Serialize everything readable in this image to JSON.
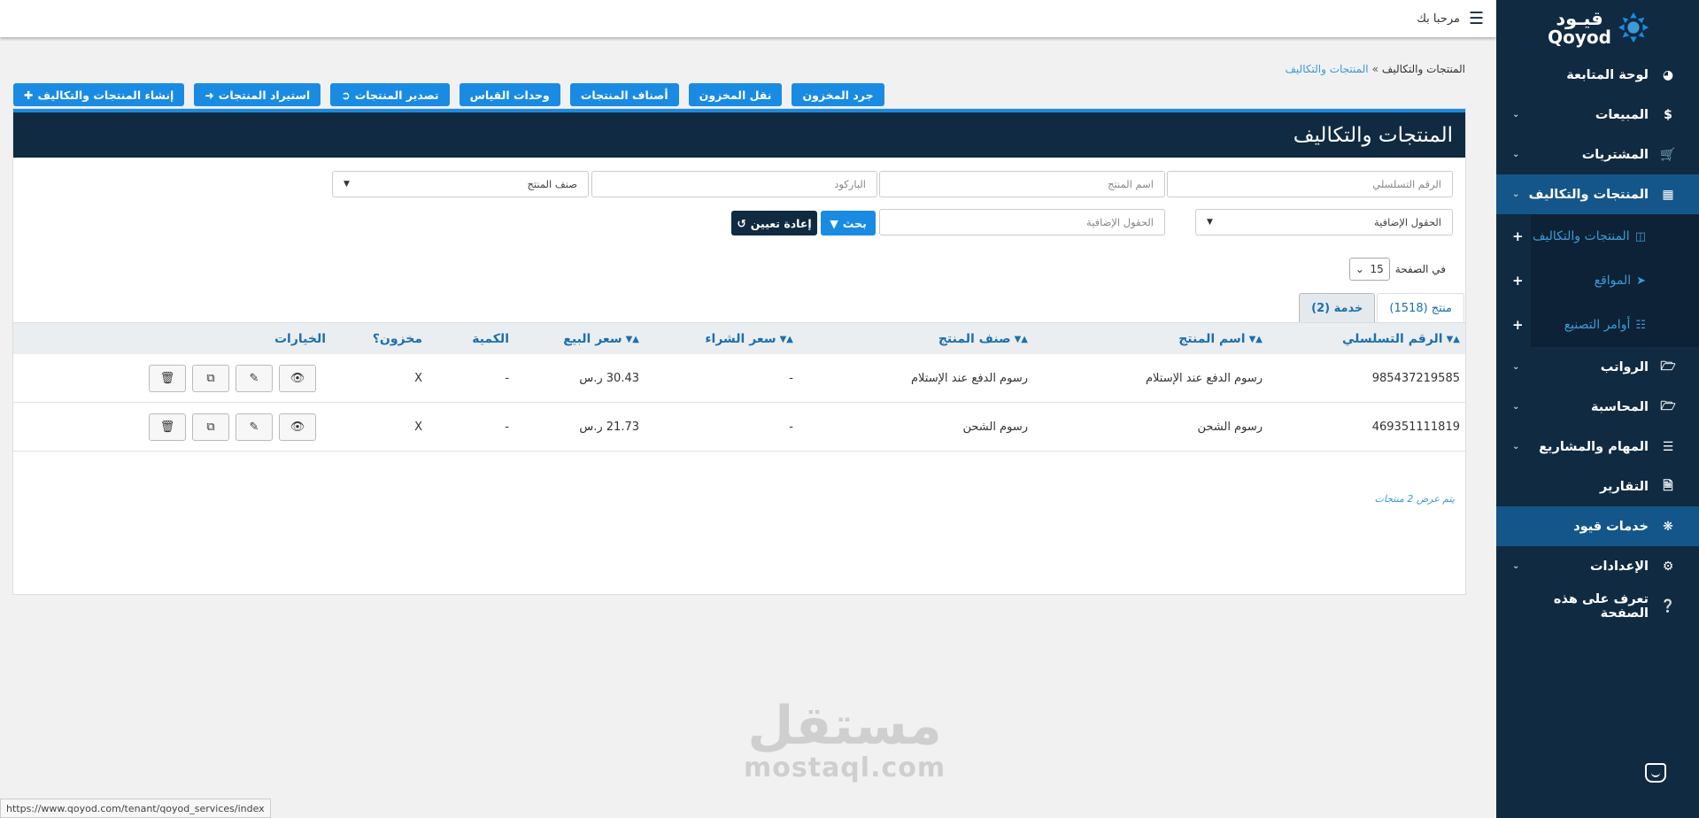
{
  "topbar": {
    "welcome": "مرحبا بك"
  },
  "sidebar": {
    "logo_ar": "قيـود",
    "logo_en": "Qoyod",
    "items": [
      {
        "label": "لوحة المتابعة",
        "icon": "dashboard-icon"
      },
      {
        "label": "المبيعات",
        "icon": "dollar-icon"
      },
      {
        "label": "المشتريات",
        "icon": "cart-icon"
      },
      {
        "label": "المنتجات والتكاليف",
        "icon": "grid-icon"
      },
      {
        "label": "الرواتب",
        "icon": "folder-icon"
      },
      {
        "label": "المحاسبة",
        "icon": "folder-icon"
      },
      {
        "label": "المهام والمشاريع",
        "icon": "list-icon"
      },
      {
        "label": "التقارير",
        "icon": "file-icon"
      },
      {
        "label": "خدمات قيود",
        "icon": "services-icon"
      },
      {
        "label": "الإعدادات",
        "icon": "gear-icon"
      },
      {
        "label": "تعرف على هذه الصفحة",
        "icon": "question-icon"
      }
    ],
    "subitems": [
      {
        "label": "المنتجات والتكاليف",
        "icon": "cubes-icon"
      },
      {
        "label": "المواقع",
        "icon": "location-arrow-icon"
      },
      {
        "label": "أوامر التصنيع",
        "icon": "sitemap-icon"
      }
    ]
  },
  "breadcrumb": {
    "current": "المنتجات والتكاليف",
    "sep": "»",
    "link": "المنتجات والتكاليف"
  },
  "actions": {
    "create": "إنشاء المنتجات والتكاليف",
    "import": "استيراد المنتجات",
    "export": "تصدير المنتجات",
    "units": "وحدات القياس",
    "categories": "أصناف المنتجات",
    "transfer": "نقل المخزون",
    "inventory": "جرد المخزون"
  },
  "panel": {
    "title": "المنتجات والتكاليف"
  },
  "filters": {
    "serial_placeholder": "الرقم التسلسلي",
    "name_placeholder": "اسم المنتج",
    "barcode_placeholder": "الباركود",
    "category_select": "صنف المنتج",
    "extra_select": "الحقول الإضافية",
    "extra_placeholder": "الحقول الإضافية",
    "search_label": "بحث",
    "reset_label": "إعادة تعيين"
  },
  "perpage": {
    "label": "في الصفحة",
    "value": "15"
  },
  "tabs": [
    {
      "label": "منتج (1518)"
    },
    {
      "label": "خدمة (2)"
    }
  ],
  "table": {
    "headers": {
      "serial": "الرقم التسلسلي",
      "name": "اسم المنتج",
      "category": "صنف المنتج",
      "buy": "سعر الشراء",
      "sell": "سعر البيع",
      "qty": "الكمية",
      "stocked": "مخزون؟",
      "options": "الخيارات"
    },
    "rows": [
      {
        "serial": "985437219585",
        "name": "رسوم الدفع عند الإستلام",
        "category": "رسوم الدفع عند الإستلام",
        "buy": "-",
        "sell": "30.43 ر.س",
        "qty": "-",
        "stocked": "X"
      },
      {
        "serial": "469351111819",
        "name": "رسوم الشحن",
        "category": "رسوم الشحن",
        "buy": "-",
        "sell": "21.73 ر.س",
        "qty": "-",
        "stocked": "X"
      }
    ]
  },
  "showing": "يتم عرض 2 منتجات",
  "watermark": {
    "ar": "مستقل",
    "en": "mostaql.com"
  },
  "statusbar": "https://www.qoyod.com/tenant/qoyod_services/index",
  "colors": {
    "navy": "#102a41",
    "accent": "#1a8be2",
    "link": "#3e9ad6",
    "active_nav": "#15568a"
  }
}
